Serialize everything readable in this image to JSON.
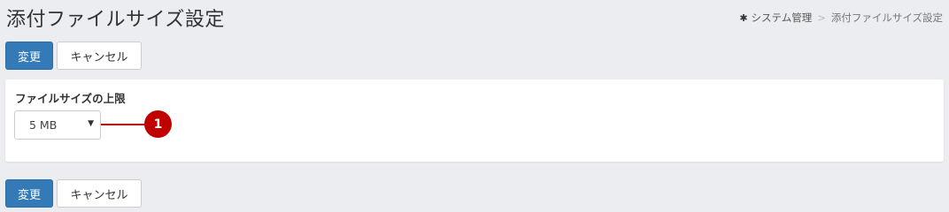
{
  "page": {
    "title": "添付ファイルサイズ設定"
  },
  "breadcrumb": {
    "icon": "gear-icon",
    "parent": "システム管理",
    "separator": ">",
    "current": "添付ファイルサイズ設定"
  },
  "actions_top": {
    "submit_label": "変更",
    "cancel_label": "キャンセル"
  },
  "form": {
    "upload_limit": {
      "label": "ファイルサイズの上限",
      "selected_value": "5 MB",
      "caret": "▼"
    }
  },
  "annotation": {
    "badge_number": "1",
    "color": "#c00000"
  },
  "actions_bottom": {
    "submit_label": "変更",
    "cancel_label": "キャンセル"
  },
  "colors": {
    "background": "#ecedf1",
    "primary": "#337ab7",
    "panel": "#ffffff"
  }
}
